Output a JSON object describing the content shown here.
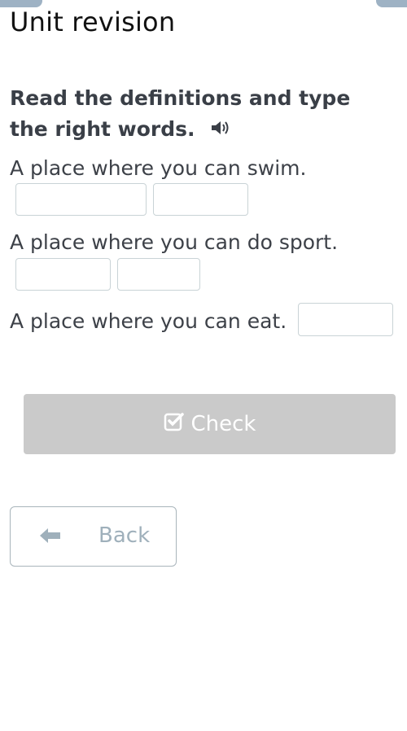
{
  "header": {
    "title": "Unit revision"
  },
  "instruction": {
    "text": "Read the definitions and type the right words.",
    "audio_icon": "speaker-icon"
  },
  "questions": [
    {
      "text": "A place where you can swim.",
      "inputs": [
        {
          "value": ""
        },
        {
          "value": ""
        }
      ]
    },
    {
      "text": "A place where you can do sport.",
      "inputs": [
        {
          "value": ""
        },
        {
          "value": ""
        }
      ]
    },
    {
      "text": "A place where you can eat.",
      "inputs": [
        {
          "value": ""
        }
      ]
    }
  ],
  "buttons": {
    "check_label": "Check",
    "check_icon": "checkbox-checked-icon",
    "back_label": "Back",
    "back_icon": "arrow-left-icon"
  },
  "colors": {
    "check_bg": "#cacaca",
    "back_text": "#9fb0bb",
    "tab_accent": "#9eb2c4"
  }
}
